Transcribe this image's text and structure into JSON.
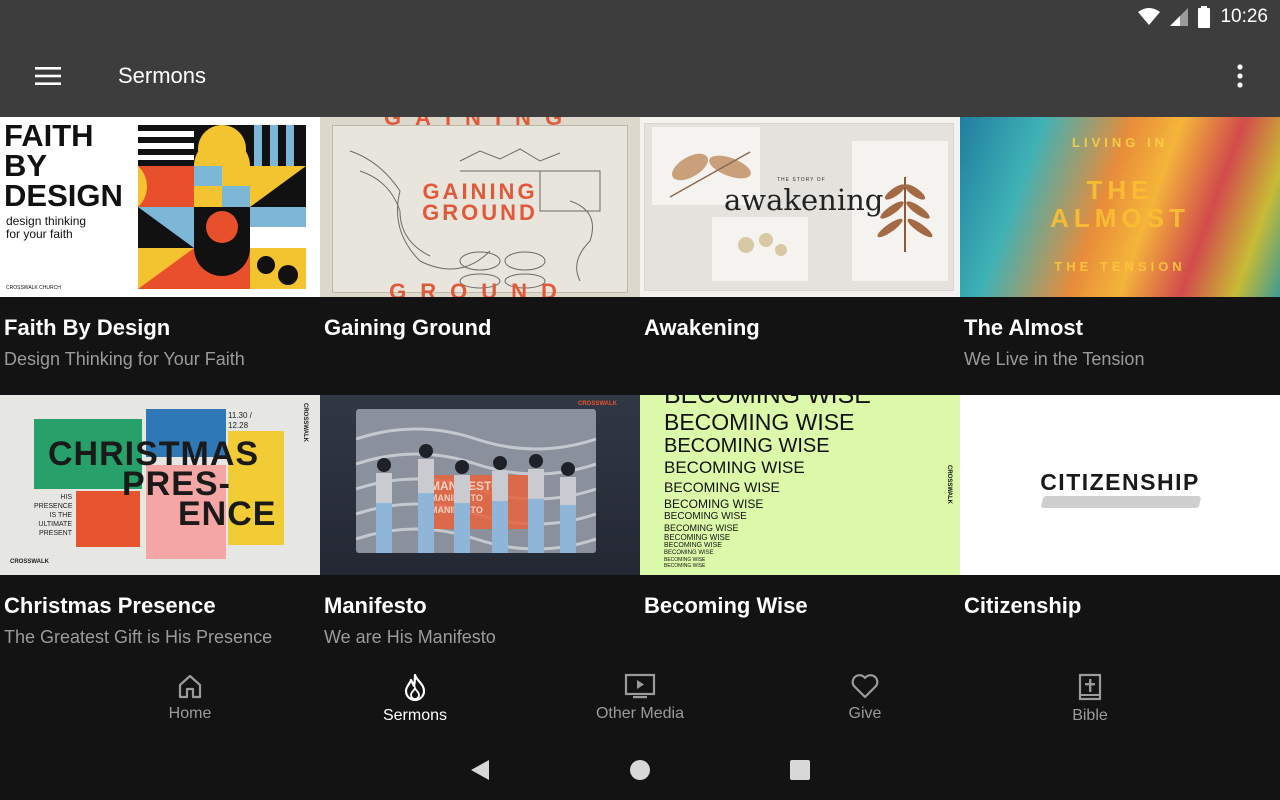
{
  "status": {
    "time": "10:26"
  },
  "app_bar": {
    "title": "Sermons"
  },
  "sermons": [
    {
      "title": "Faith By Design",
      "subtitle": "Design Thinking for Your Faith",
      "art_lines": [
        "FAITH",
        "BY",
        "DESIGN"
      ],
      "art_sub": "design thinking\nfor your faith",
      "art_footer": "CROSSWALK CHURCH"
    },
    {
      "title": "Gaining Ground",
      "subtitle": "",
      "art_lines": [
        "GAINING",
        "GROUND"
      ]
    },
    {
      "title": "Awakening",
      "subtitle": "",
      "art_pre": "THE STORY OF",
      "art_word": "awakening"
    },
    {
      "title": "The Almost",
      "subtitle": "We Live in the Tension",
      "art_top": "LIVING IN",
      "art_mid1": "THE",
      "art_mid2": "ALMOST",
      "art_bottom": "THE TENSION"
    },
    {
      "title": "Christmas Presence",
      "subtitle": "The Greatest Gift is His Presence",
      "art_a": "CHRISTMAS",
      "art_b": "PRES-",
      "art_c": "ENCE",
      "art_small": "HIS\nPRESENCE\nIS THE\nULTIMATE\nPRESENT",
      "art_date": "11.30 /\n12.28",
      "art_brand": "CROSSWALK"
    },
    {
      "title": "Manifesto",
      "subtitle": "We are His Manifesto",
      "art_word": "MANIFESTO",
      "art_brand": "CROSSWALK"
    },
    {
      "title": "Becoming Wise",
      "subtitle": "",
      "art_word": "BECOMING WISE",
      "art_brand": "CROSSWALK"
    },
    {
      "title": "Citizenship",
      "subtitle": "",
      "art_word": "CITIZENSHIP"
    }
  ],
  "bottom_nav": [
    {
      "label": "Home",
      "icon": "home-icon"
    },
    {
      "label": "Sermons",
      "icon": "flame-icon",
      "active": true
    },
    {
      "label": "Other Media",
      "icon": "play-screen-icon"
    },
    {
      "label": "Give",
      "icon": "heart-icon"
    },
    {
      "label": "Bible",
      "icon": "bible-icon"
    }
  ],
  "colors": {
    "bar": "#3d3d3d",
    "bg": "#131314",
    "subtitle": "#9b9b9b"
  }
}
